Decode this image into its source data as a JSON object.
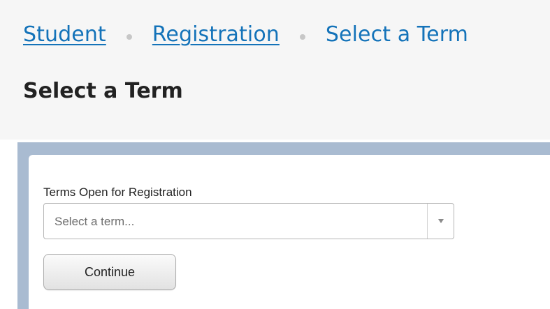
{
  "breadcrumb": {
    "items": [
      {
        "label": "Student"
      },
      {
        "label": "Registration"
      }
    ],
    "current": "Select a Term"
  },
  "page": {
    "title": "Select a Term"
  },
  "form": {
    "term_label": "Terms Open for Registration",
    "term_select": {
      "placeholder": "Select a term...",
      "value": "",
      "icon": "chevron-down-icon"
    },
    "continue_label": "Continue"
  },
  "colors": {
    "link": "#1473b9",
    "panel_border": "#a9bbd1",
    "header_background": "#f6f6f6"
  }
}
